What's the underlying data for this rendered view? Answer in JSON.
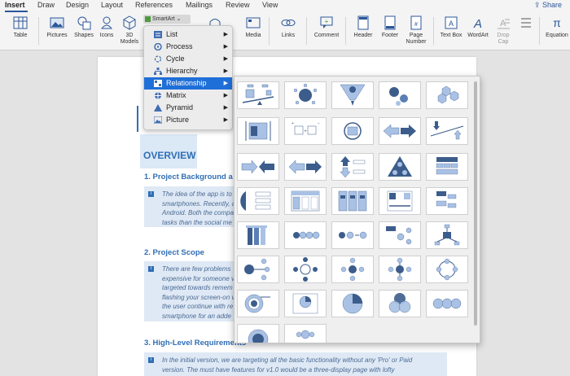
{
  "tabs": [
    "Insert",
    "Draw",
    "Design",
    "Layout",
    "References",
    "Mailings",
    "Review",
    "View"
  ],
  "share_label": "Share",
  "ribbon": {
    "table": "Table",
    "pictures": "Pictures",
    "shapes": "Shapes",
    "icons": "Icons",
    "models_line1": "3D",
    "models_line2": "Models",
    "smartart": "SmartArt",
    "media": "Media",
    "links": "Links",
    "comment": "Comment",
    "header": "Header",
    "footer": "Footer",
    "page_number_line1": "Page",
    "page_number_line2": "Number",
    "text_box": "Text Box",
    "wordart": "WordArt",
    "drop_cap_line1": "Drop",
    "drop_cap_line2": "Cap",
    "equation": "Equation"
  },
  "smartart_menu": {
    "items": [
      {
        "label": "List",
        "icon": "list-icon"
      },
      {
        "label": "Process",
        "icon": "process-icon"
      },
      {
        "label": "Cycle",
        "icon": "cycle-icon"
      },
      {
        "label": "Hierarchy",
        "icon": "hierarchy-icon"
      },
      {
        "label": "Relationship",
        "icon": "relationship-icon"
      },
      {
        "label": "Matrix",
        "icon": "matrix-icon"
      },
      {
        "label": "Pyramid",
        "icon": "pyramid-icon"
      },
      {
        "label": "Picture",
        "icon": "picture-icon"
      }
    ],
    "selected": "Relationship"
  },
  "document": {
    "overview": "OVERVIEW",
    "h1": "1.  Project Background a",
    "p1": [
      "The idea of the app is to",
      "smartphones. Recently, a",
      "Android. Both the compa",
      "tasks than the social me"
    ],
    "h2": "2.  Project Scope",
    "p2": [
      "There are few problems",
      "expensive for someone v",
      "targeted towards remem",
      "flashing your screen-on v",
      "the user continue with re",
      "smartphone for an adde"
    ],
    "h3": "3.  High-Level Requirements",
    "p3": [
      "In the initial version, we are targeting all the basic functionality without any 'Pro' or Paid",
      "version. The must have features for v1.0 would be a three-display page with lofty"
    ]
  },
  "colors": {
    "accent": "#2f6eb5",
    "selection": "#1f6fd8",
    "diagram_fill": "#a9c1e4",
    "diagram_dark": "#3c5d8c"
  }
}
